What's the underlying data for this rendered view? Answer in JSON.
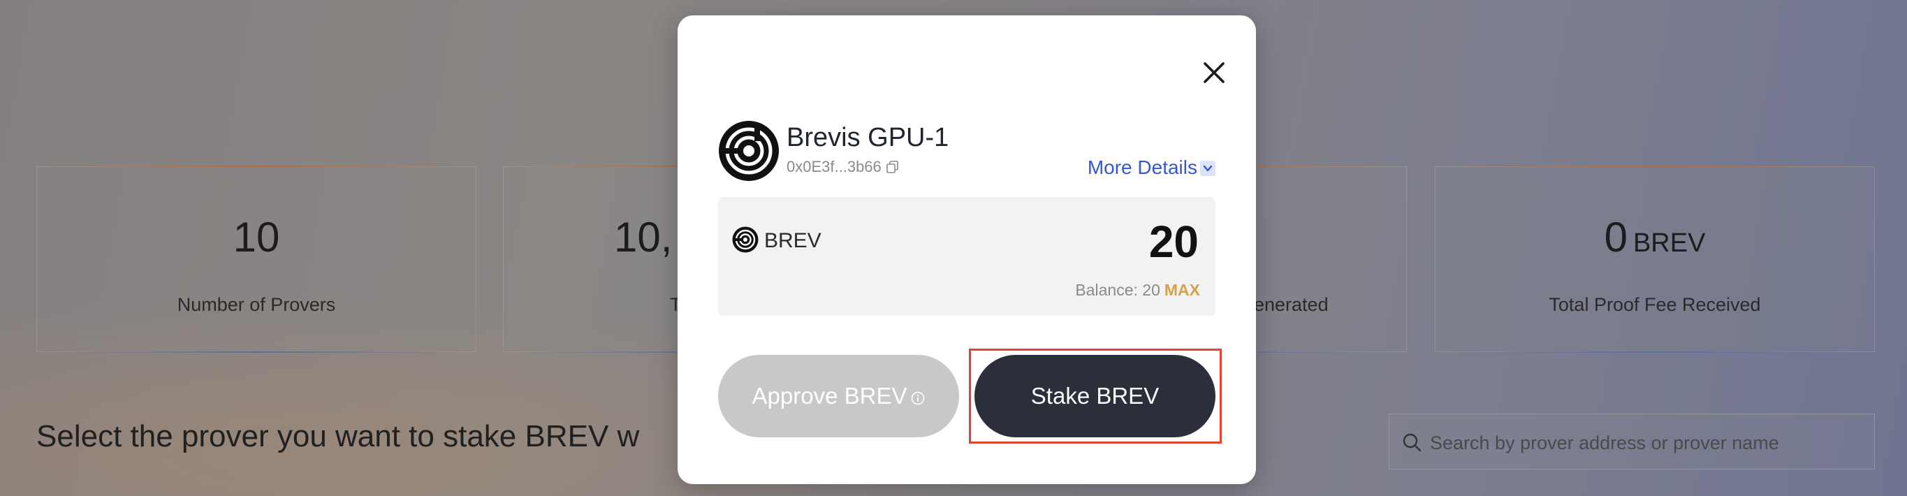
{
  "stats": [
    {
      "value": "10",
      "unit": "",
      "label": "Number of Provers"
    },
    {
      "value": "10,",
      "unit": "",
      "label": "T"
    },
    {
      "value": "",
      "unit": "",
      "label": "enerated"
    },
    {
      "value": "0",
      "unit": "BREV",
      "label": "Total Proof Fee Received"
    }
  ],
  "section_heading": "Select the prover you want to stake BREV w",
  "search": {
    "placeholder": "Search by prover address or prover name",
    "value": ""
  },
  "modal": {
    "prover_name": "Brevis GPU-1",
    "prover_address": "0x0E3f...3b66",
    "more_details_label": "More Details",
    "token_symbol": "BREV",
    "amount": "20",
    "balance_label": "Balance: 20",
    "max_label": "MAX",
    "approve_label": "Approve BREV",
    "stake_label": "Stake BREV",
    "icons": {
      "close": "close-icon",
      "copy": "copy-icon",
      "info": "info-icon",
      "chevron": "chevron-down-icon"
    }
  },
  "colors": {
    "accent_blue": "#3457d5",
    "max_gold": "#d4a24c",
    "stake_button": "#2b2f39",
    "approve_disabled": "#c8c8c8",
    "highlight": "#e2452f"
  }
}
